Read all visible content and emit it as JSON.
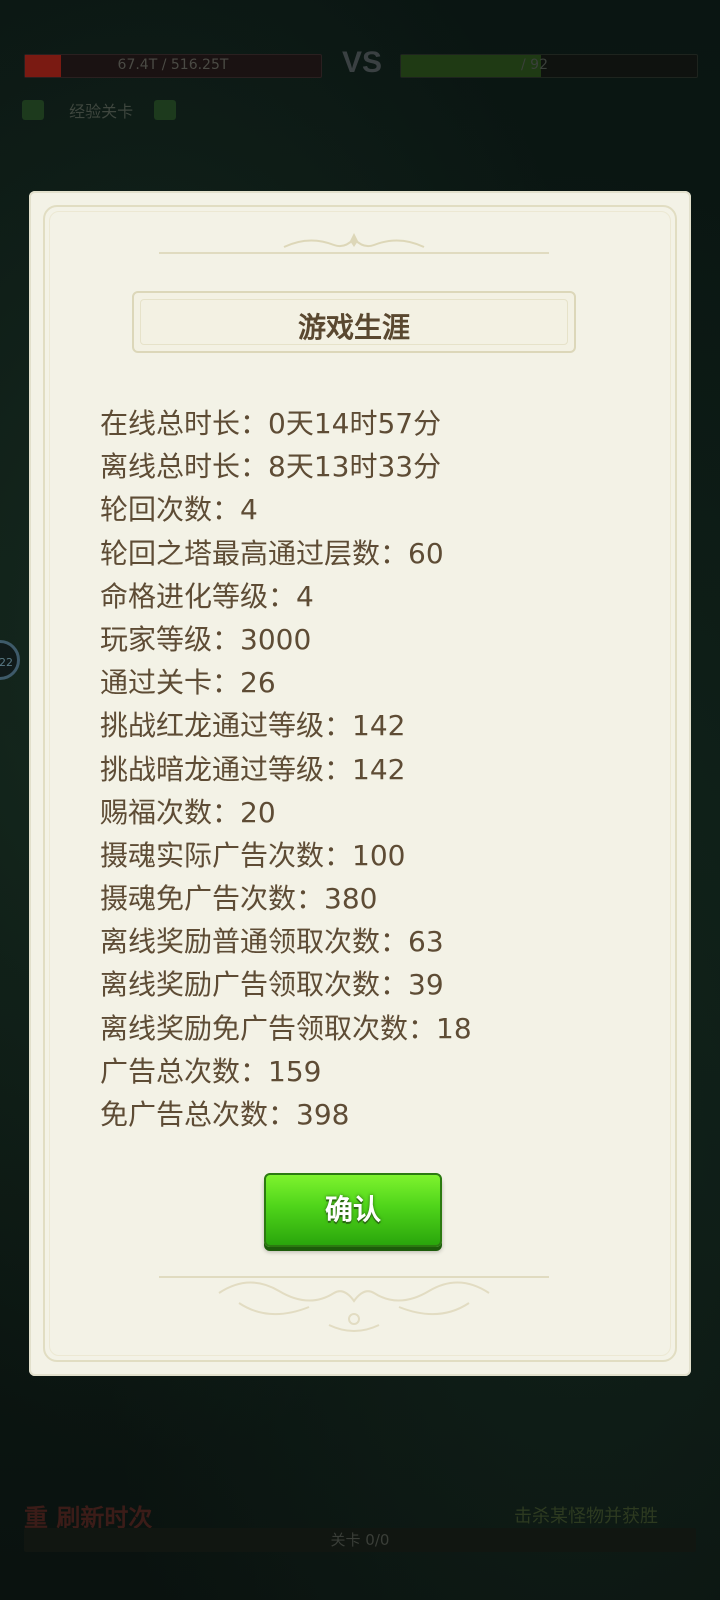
{
  "hud": {
    "left_bar_text": "67.4T / 516.25T",
    "vs_label": "VS",
    "right_bar_text": "/ 92",
    "stage_label": "经验关卡"
  },
  "side_badge": "22",
  "bottom": {
    "title": "重 刷新时次",
    "right_text": "击杀某怪物并获胜",
    "bar_text": "关卡 0/0"
  },
  "modal": {
    "title": "游戏生涯",
    "stats": [
      "在线总时长：0天14时57分",
      "离线总时长：8天13时33分",
      "轮回次数：4",
      "轮回之塔最高通过层数：60",
      "命格进化等级：4",
      "玩家等级：3000",
      "通过关卡：26",
      "挑战红龙通过等级：142",
      "挑战暗龙通过等级：142",
      "赐福次数：20",
      "摄魂实际广告次数：100",
      "摄魂免广告次数：380",
      "离线奖励普通领取次数：63",
      "离线奖励广告领取次数：39",
      "离线奖励免广告领取次数：18",
      "广告总次数：159",
      "免广告总次数：398"
    ],
    "confirm_label": "确认"
  },
  "colors": {
    "panel_bg": "#f3f2e6",
    "text_brown": "#5e4c35",
    "button_green": "#4fd41a"
  }
}
